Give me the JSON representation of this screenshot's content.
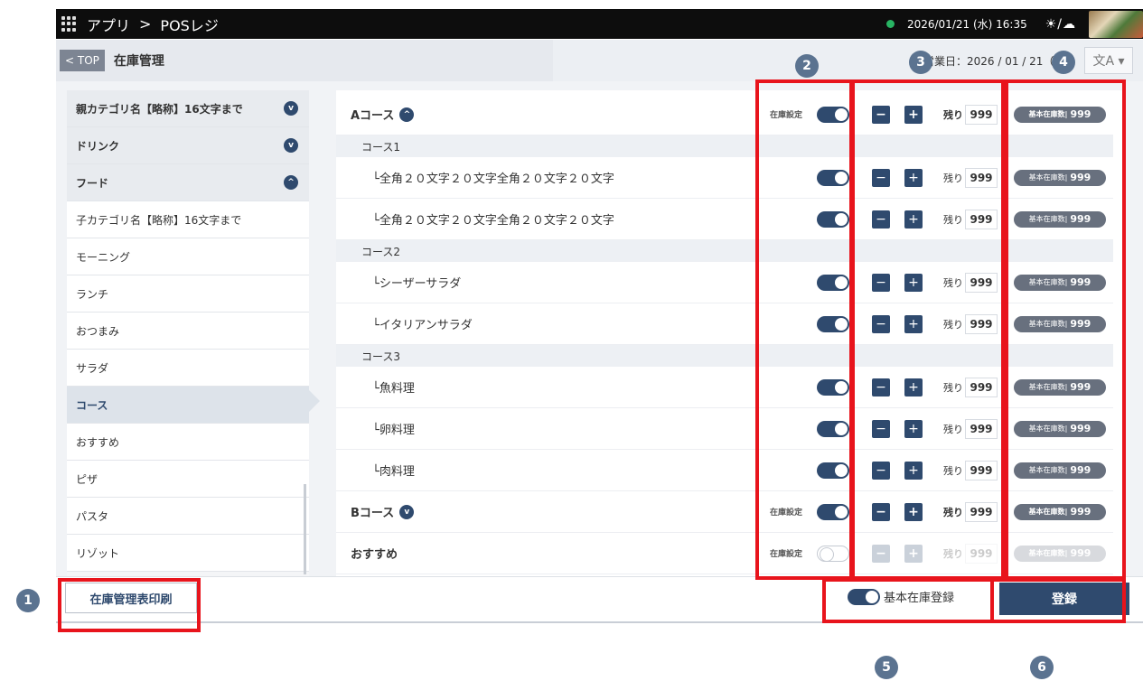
{
  "topbar": {
    "app_label": "アプリ",
    "separator": ">",
    "app_name": "POSレジ",
    "datetime": "2026/01/21 (水) 16:35",
    "weather": "☀/☁"
  },
  "subheader": {
    "top_button": "< TOP",
    "title": "在庫管理",
    "business_date": "営業日：2026 / 01 / 21（",
    "lang_icon": "文A ▾"
  },
  "sidebar": {
    "items": [
      {
        "label": "親カテゴリ名【略称】16文字まで",
        "kind": "parent",
        "toggle": "v"
      },
      {
        "label": "ドリンク",
        "kind": "parent",
        "toggle": "v"
      },
      {
        "label": "フード",
        "kind": "parent",
        "toggle": "^"
      },
      {
        "label": "子カテゴリ名【略称】16文字まで",
        "kind": "child"
      },
      {
        "label": "モーニング",
        "kind": "child"
      },
      {
        "label": "ランチ",
        "kind": "child"
      },
      {
        "label": "おつまみ",
        "kind": "child"
      },
      {
        "label": "サラダ",
        "kind": "child"
      },
      {
        "label": "コース",
        "kind": "active"
      },
      {
        "label": "おすすめ",
        "kind": "child"
      },
      {
        "label": "ピザ",
        "kind": "child"
      },
      {
        "label": "パスタ",
        "kind": "child"
      },
      {
        "label": "リゾット",
        "kind": "child"
      }
    ]
  },
  "main": {
    "stock_setting_label": "在庫設定",
    "remain_label": "残り",
    "base_label": "基本在庫数",
    "rows": [
      {
        "type": "course",
        "label": "Aコース",
        "chev": "^",
        "remain": "999",
        "base": "999"
      },
      {
        "type": "sub",
        "label": "コース1"
      },
      {
        "type": "item",
        "label": "└全角２０文字２０文字全角２０文字２０文字",
        "remain": "999",
        "base": "999"
      },
      {
        "type": "item",
        "label": "└全角２０文字２０文字全角２０文字２０文字",
        "remain": "999",
        "base": "999"
      },
      {
        "type": "sub",
        "label": "コース2"
      },
      {
        "type": "item",
        "label": "└シーザーサラダ",
        "remain": "999",
        "base": "999"
      },
      {
        "type": "item",
        "label": "└イタリアンサラダ",
        "remain": "999",
        "base": "999"
      },
      {
        "type": "sub",
        "label": "コース3"
      },
      {
        "type": "item",
        "label": "└魚料理",
        "remain": "999",
        "base": "999"
      },
      {
        "type": "item",
        "label": "└卵料理",
        "remain": "999",
        "base": "999"
      },
      {
        "type": "item",
        "label": "└肉料理",
        "remain": "999",
        "base": "999"
      },
      {
        "type": "course",
        "label": "Bコース",
        "chev": "v",
        "remain": "999",
        "base": "999"
      },
      {
        "type": "course",
        "label": "おすすめ",
        "remain": "999",
        "base": "999",
        "off": true
      }
    ]
  },
  "footer": {
    "print_button": "在庫管理表印刷",
    "basic_register_label": "基本在庫登録",
    "register_button": "登録"
  },
  "annotations": [
    "1",
    "2",
    "3",
    "4",
    "5",
    "6"
  ],
  "colors": {
    "accent": "#2f4a6e",
    "highlight": "#e8141c",
    "badge": "#5b7390"
  }
}
